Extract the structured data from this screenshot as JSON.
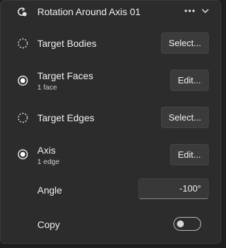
{
  "header": {
    "icon": "rotate-axis-icon",
    "title": "Rotation Around Axis 01",
    "more_label": "•••",
    "collapse_icon": "chevron-down-icon"
  },
  "rows": {
    "target_bodies": {
      "label": "Target Bodies",
      "state": "unselected",
      "button": "Select..."
    },
    "target_faces": {
      "label": "Target Faces",
      "sub": "1 face",
      "state": "selected",
      "button": "Edit..."
    },
    "target_edges": {
      "label": "Target Edges",
      "state": "unselected",
      "button": "Select..."
    },
    "axis": {
      "label": "Axis",
      "sub": "1 edge",
      "state": "selected",
      "button": "Edit..."
    },
    "angle": {
      "label": "Angle",
      "value": "-100°"
    },
    "copy": {
      "label": "Copy",
      "enabled": false
    }
  },
  "colors": {
    "panel_bg": "#2c2c2c",
    "button_bg": "#3b3b3b",
    "text": "#f0f0f0"
  }
}
